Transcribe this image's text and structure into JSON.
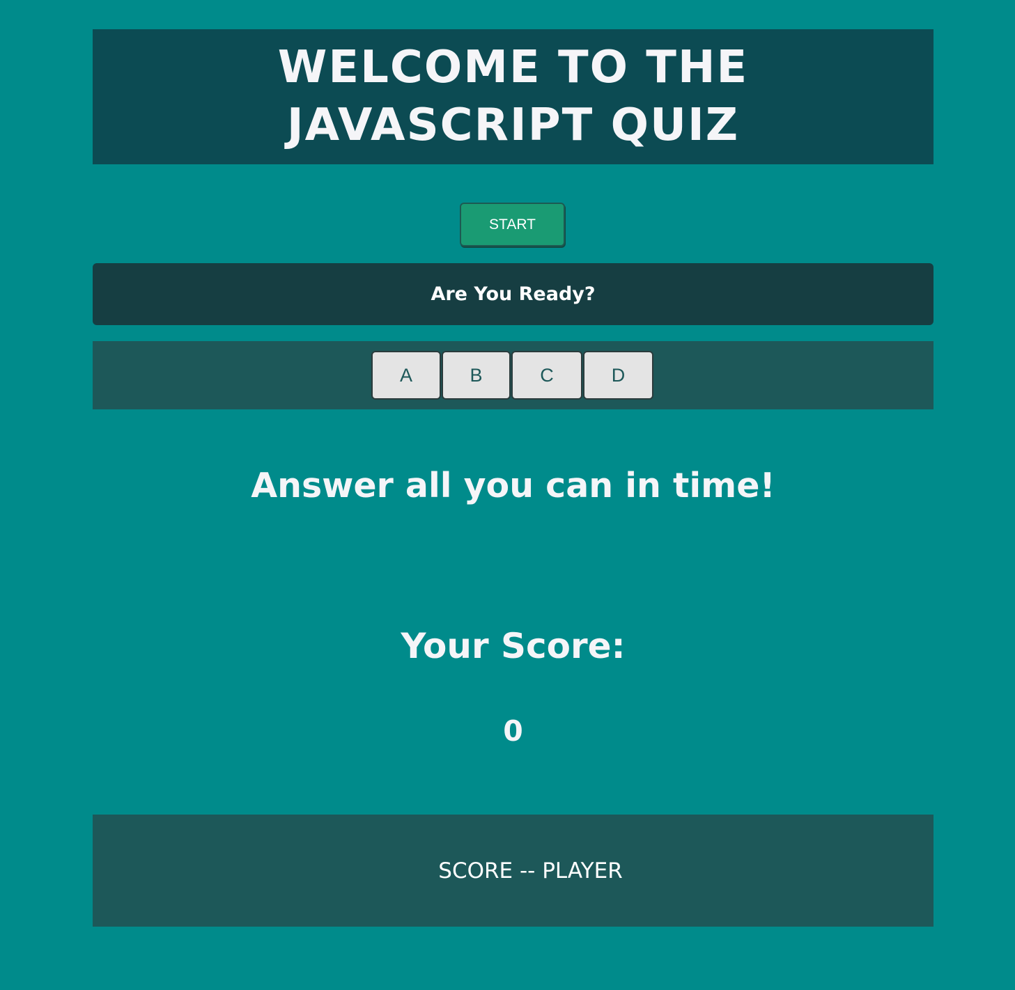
{
  "header": {
    "title": "WELCOME TO THE JAVASCRIPT QUIZ"
  },
  "controls": {
    "start_label": "START"
  },
  "question": {
    "text": "Are You Ready?"
  },
  "answers": [
    {
      "label": "A"
    },
    {
      "label": "B"
    },
    {
      "label": "C"
    },
    {
      "label": "D"
    }
  ],
  "instruction": "Answer all you can in time!",
  "score": {
    "heading": "Your Score:",
    "value": "0"
  },
  "scoreboard": {
    "text": "SCORE -- PLAYER"
  },
  "colors": {
    "background": "#008b8b",
    "header_bg": "#0c4b53",
    "start_button": "#1a9b73",
    "question_bg": "#163e42",
    "panel_bg": "#1d5859",
    "answer_button": "#e4e4e4"
  }
}
